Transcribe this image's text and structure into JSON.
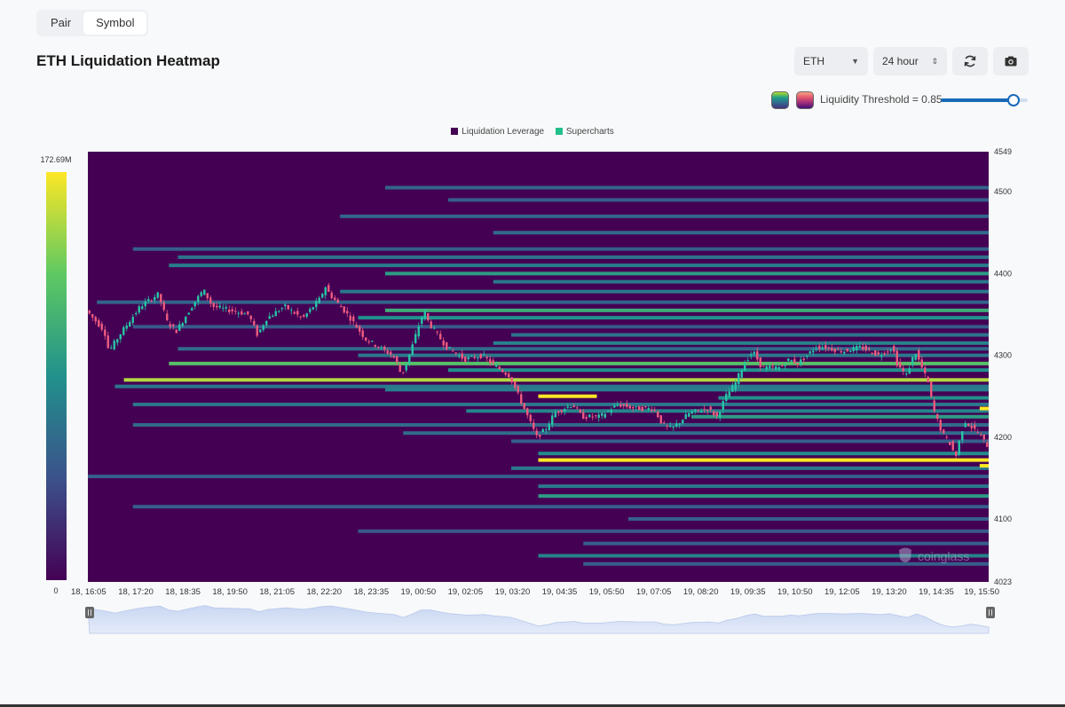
{
  "tabs": [
    {
      "label": "Pair",
      "active": false
    },
    {
      "label": "Symbol",
      "active": true
    }
  ],
  "title": "ETH Liquidation Heatmap",
  "controls": {
    "coin": "ETH",
    "range": "24 hour",
    "refresh_icon": "refresh-icon",
    "screenshot_icon": "camera-icon",
    "threshold_label": "Liquidity Threshold = 0.85",
    "threshold_value": 0.85,
    "palette_icons": [
      "viridis-palette-icon",
      "warm-palette-icon"
    ]
  },
  "colors": {
    "background": "#440154",
    "cool": "#21918c",
    "bright": "#fde725",
    "candle_up": "#26c6a6",
    "candle_down": "#ef5b7f"
  },
  "watermark": "coinglass",
  "chart_data": {
    "type": "heatmap",
    "legend": [
      "Liquidation Leverage",
      "Supercharts"
    ],
    "legend_colors": [
      "#440154",
      "#22c08a"
    ],
    "colorbar": {
      "min": 0,
      "max": 172.69,
      "min_label": "0",
      "max_label": "172.69M"
    },
    "y_ticks": [
      4549,
      4500,
      4400,
      4300,
      4200,
      4100,
      4023
    ],
    "ylim": [
      4023,
      4549
    ],
    "x_ticks": [
      "18, 16:05",
      "18, 17:20",
      "18, 18:35",
      "18, 19:50",
      "18, 21:05",
      "18, 22:20",
      "18, 23:35",
      "19, 00:50",
      "19, 02:05",
      "19, 03:20",
      "19, 04:35",
      "19, 05:50",
      "19, 07:05",
      "19, 08:20",
      "19, 09:35",
      "19, 10:50",
      "19, 12:05",
      "19, 13:20",
      "19, 14:35",
      "19, 15:50"
    ],
    "bands": [
      {
        "price": 4505,
        "start": 0.33,
        "value": 0.32
      },
      {
        "price": 4490,
        "start": 0.4,
        "value": 0.3
      },
      {
        "price": 4470,
        "start": 0.28,
        "value": 0.33
      },
      {
        "price": 4450,
        "start": 0.45,
        "value": 0.35
      },
      {
        "price": 4430,
        "start": 0.05,
        "value": 0.3
      },
      {
        "price": 4420,
        "start": 0.1,
        "value": 0.38
      },
      {
        "price": 4410,
        "start": 0.09,
        "value": 0.42
      },
      {
        "price": 4400,
        "start": 0.33,
        "value": 0.55
      },
      {
        "price": 4390,
        "start": 0.45,
        "value": 0.4
      },
      {
        "price": 4378,
        "start": 0.28,
        "value": 0.4
      },
      {
        "price": 4365,
        "start": 0.01,
        "value": 0.32
      },
      {
        "price": 4355,
        "start": 0.33,
        "value": 0.62
      },
      {
        "price": 4346,
        "start": 0.3,
        "value": 0.5
      },
      {
        "price": 4335,
        "start": 0.05,
        "value": 0.28
      },
      {
        "price": 4325,
        "start": 0.47,
        "value": 0.38
      },
      {
        "price": 4315,
        "start": 0.45,
        "value": 0.45
      },
      {
        "price": 4308,
        "start": 0.1,
        "value": 0.35
      },
      {
        "price": 4300,
        "start": 0.3,
        "value": 0.4
      },
      {
        "price": 4290,
        "start": 0.09,
        "value": 0.72
      },
      {
        "price": 4282,
        "start": 0.4,
        "value": 0.5
      },
      {
        "price": 4270,
        "start": 0.04,
        "value": 0.88
      },
      {
        "price": 4262,
        "start": 0.03,
        "value": 0.4
      },
      {
        "price": 4258,
        "start": 0.33,
        "value": 0.42
      },
      {
        "price": 4248,
        "start": 0.7,
        "value": 0.5
      },
      {
        "price": 4240,
        "start": 0.05,
        "value": 0.4
      },
      {
        "price": 4232,
        "start": 0.42,
        "value": 0.45
      },
      {
        "price": 4225,
        "start": 0.67,
        "value": 0.55
      },
      {
        "price": 4215,
        "start": 0.05,
        "value": 0.35
      },
      {
        "price": 4205,
        "start": 0.35,
        "value": 0.35
      },
      {
        "price": 4195,
        "start": 0.47,
        "value": 0.3
      },
      {
        "price": 4180,
        "start": 0.5,
        "value": 0.48
      },
      {
        "price": 4172,
        "start": 0.5,
        "value": 1.0
      },
      {
        "price": 4162,
        "start": 0.47,
        "value": 0.4
      },
      {
        "price": 4152,
        "start": 0.0,
        "value": 0.3
      },
      {
        "price": 4140,
        "start": 0.5,
        "value": 0.4
      },
      {
        "price": 4128,
        "start": 0.5,
        "value": 0.55
      },
      {
        "price": 4115,
        "start": 0.05,
        "value": 0.3
      },
      {
        "price": 4100,
        "start": 0.6,
        "value": 0.3
      },
      {
        "price": 4085,
        "start": 0.3,
        "value": 0.28
      },
      {
        "price": 4070,
        "start": 0.55,
        "value": 0.3
      },
      {
        "price": 4055,
        "start": 0.5,
        "value": 0.45
      },
      {
        "price": 4045,
        "start": 0.55,
        "value": 0.3
      }
    ],
    "short_bands": [
      {
        "price": 4250,
        "start": 0.5,
        "end": 0.565,
        "value": 1.0
      },
      {
        "price": 4235,
        "start": 0.99,
        "end": 1.0,
        "value": 1.0
      },
      {
        "price": 4165,
        "start": 0.99,
        "end": 1.0,
        "value": 1.0
      }
    ],
    "price_path": [
      [
        0.0,
        4355
      ],
      [
        0.02,
        4330
      ],
      [
        0.025,
        4305
      ],
      [
        0.04,
        4330
      ],
      [
        0.06,
        4360
      ],
      [
        0.08,
        4375
      ],
      [
        0.09,
        4340
      ],
      [
        0.1,
        4330
      ],
      [
        0.12,
        4365
      ],
      [
        0.13,
        4380
      ],
      [
        0.14,
        4360
      ],
      [
        0.16,
        4355
      ],
      [
        0.18,
        4350
      ],
      [
        0.19,
        4325
      ],
      [
        0.2,
        4345
      ],
      [
        0.22,
        4360
      ],
      [
        0.24,
        4345
      ],
      [
        0.26,
        4370
      ],
      [
        0.265,
        4385
      ],
      [
        0.27,
        4375
      ],
      [
        0.29,
        4350
      ],
      [
        0.31,
        4320
      ],
      [
        0.325,
        4310
      ],
      [
        0.34,
        4300
      ],
      [
        0.345,
        4290
      ],
      [
        0.35,
        4275
      ],
      [
        0.36,
        4305
      ],
      [
        0.37,
        4340
      ],
      [
        0.375,
        4355
      ],
      [
        0.38,
        4340
      ],
      [
        0.4,
        4310
      ],
      [
        0.42,
        4295
      ],
      [
        0.44,
        4300
      ],
      [
        0.45,
        4290
      ],
      [
        0.47,
        4275
      ],
      [
        0.48,
        4250
      ],
      [
        0.49,
        4225
      ],
      [
        0.5,
        4200
      ],
      [
        0.51,
        4210
      ],
      [
        0.52,
        4230
      ],
      [
        0.54,
        4240
      ],
      [
        0.55,
        4225
      ],
      [
        0.57,
        4225
      ],
      [
        0.59,
        4240
      ],
      [
        0.61,
        4235
      ],
      [
        0.63,
        4235
      ],
      [
        0.64,
        4215
      ],
      [
        0.65,
        4210
      ],
      [
        0.67,
        4230
      ],
      [
        0.69,
        4235
      ],
      [
        0.7,
        4225
      ],
      [
        0.71,
        4250
      ],
      [
        0.72,
        4265
      ],
      [
        0.73,
        4290
      ],
      [
        0.74,
        4305
      ],
      [
        0.75,
        4285
      ],
      [
        0.77,
        4285
      ],
      [
        0.78,
        4295
      ],
      [
        0.79,
        4290
      ],
      [
        0.8,
        4300
      ],
      [
        0.81,
        4310
      ],
      [
        0.82,
        4310
      ],
      [
        0.84,
        4305
      ],
      [
        0.86,
        4310
      ],
      [
        0.88,
        4300
      ],
      [
        0.895,
        4310
      ],
      [
        0.9,
        4290
      ],
      [
        0.91,
        4275
      ],
      [
        0.92,
        4305
      ],
      [
        0.935,
        4265
      ],
      [
        0.94,
        4235
      ],
      [
        0.95,
        4205
      ],
      [
        0.96,
        4190
      ],
      [
        0.965,
        4175
      ],
      [
        0.97,
        4200
      ],
      [
        0.975,
        4220
      ],
      [
        0.98,
        4215
      ],
      [
        0.99,
        4205
      ],
      [
        1.0,
        4190
      ]
    ]
  }
}
